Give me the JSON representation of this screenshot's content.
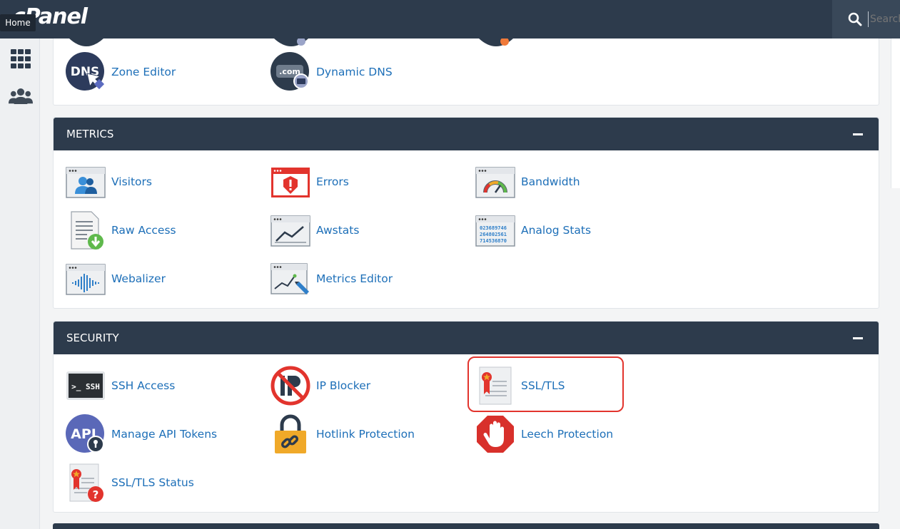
{
  "app": {
    "logo": "cPanel",
    "home_tooltip": "Home"
  },
  "search": {
    "placeholder": "Search"
  },
  "domains_partial": {
    "items": [
      {
        "label": "Zone Editor",
        "icon": "dns-zone-editor-icon"
      },
      {
        "label": "Dynamic DNS",
        "icon": "dynamic-dns-icon"
      }
    ]
  },
  "metrics": {
    "title": "METRICS",
    "items": [
      {
        "label": "Visitors",
        "icon": "visitors-icon"
      },
      {
        "label": "Errors",
        "icon": "errors-icon"
      },
      {
        "label": "Bandwidth",
        "icon": "bandwidth-icon"
      },
      {
        "label": "Raw Access",
        "icon": "raw-access-icon"
      },
      {
        "label": "Awstats",
        "icon": "awstats-icon"
      },
      {
        "label": "Analog Stats",
        "icon": "analog-stats-icon"
      },
      {
        "label": "Webalizer",
        "icon": "webalizer-icon"
      },
      {
        "label": "Metrics Editor",
        "icon": "metrics-editor-icon"
      }
    ]
  },
  "security": {
    "title": "SECURITY",
    "items": [
      {
        "label": "SSH Access",
        "icon": "ssh-access-icon"
      },
      {
        "label": "IP Blocker",
        "icon": "ip-blocker-icon"
      },
      {
        "label": "SSL/TLS",
        "icon": "ssl-tls-icon"
      },
      {
        "label": "Manage API Tokens",
        "icon": "api-tokens-icon"
      },
      {
        "label": "Hotlink Protection",
        "icon": "hotlink-protection-icon"
      },
      {
        "label": "Leech Protection",
        "icon": "leech-protection-icon"
      },
      {
        "label": "SSL/TLS Status",
        "icon": "ssl-tls-status-icon"
      }
    ]
  },
  "icon_text": {
    "dns": "DNS",
    "com": ".com",
    "ssh": ">_ SSH",
    "api": "API",
    "analog_digits": [
      "023689746",
      "264802561",
      "714536870"
    ]
  },
  "colors": {
    "header_bg": "#2d3b4c",
    "link": "#1d6fb8",
    "highlight": "#e2342d",
    "error_red": "#e2342d",
    "leech_red": "#d8302b",
    "hotlink_orange": "#f0a929"
  }
}
